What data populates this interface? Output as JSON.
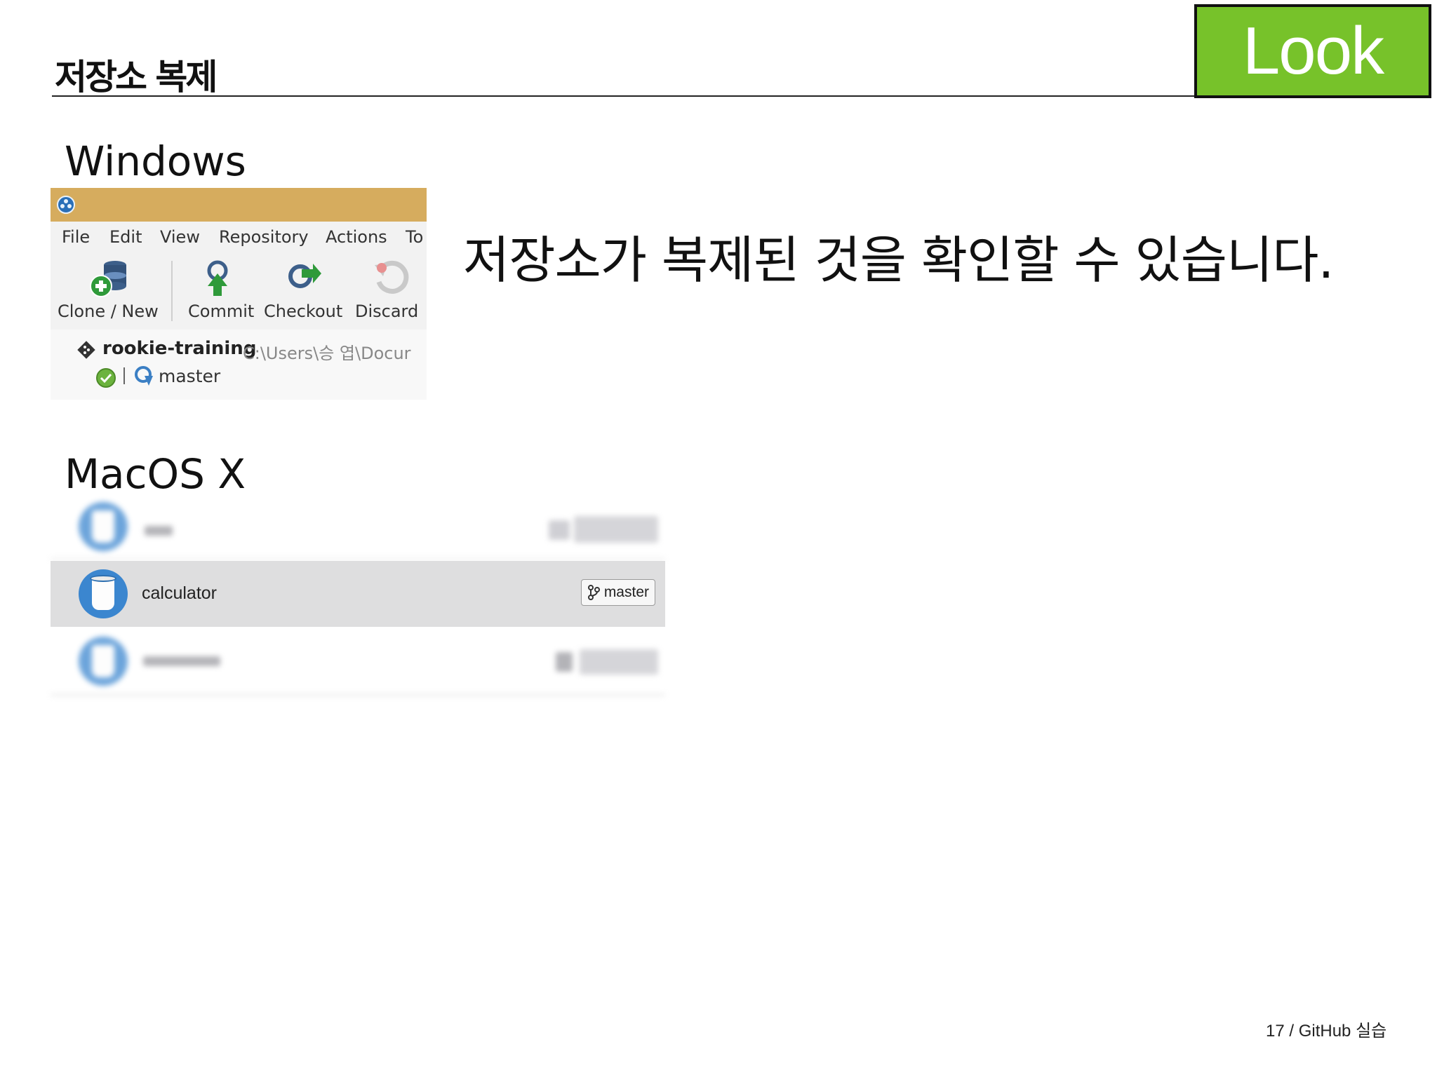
{
  "slide": {
    "title": "저장소 복제",
    "badge": "Look",
    "message": "저장소가 복제된 것을 확인할 수 있습니다.",
    "footer": "17 / GitHub 실습"
  },
  "windows": {
    "label": "Windows",
    "menu": [
      "File",
      "Edit",
      "View",
      "Repository",
      "Actions",
      "To"
    ],
    "toolbar": {
      "clone": "Clone / New",
      "commit": "Commit",
      "checkout": "Checkout",
      "discard": "Discard"
    },
    "repo": {
      "name": "rookie-training",
      "path": "C:\\Users\\승 엽\\Docur",
      "branch": "master"
    }
  },
  "mac": {
    "label": "MacOS X",
    "repos": [
      {
        "name": "",
        "blurred": true
      },
      {
        "name": "calculator",
        "branch": "master",
        "selected": true
      },
      {
        "name": "",
        "blurred": true
      }
    ]
  },
  "colors": {
    "badge_bg": "#77c22a",
    "titlebar": "#d6ac5e",
    "repo_icon": "#3b86cf",
    "selected_row": "#dededf"
  }
}
